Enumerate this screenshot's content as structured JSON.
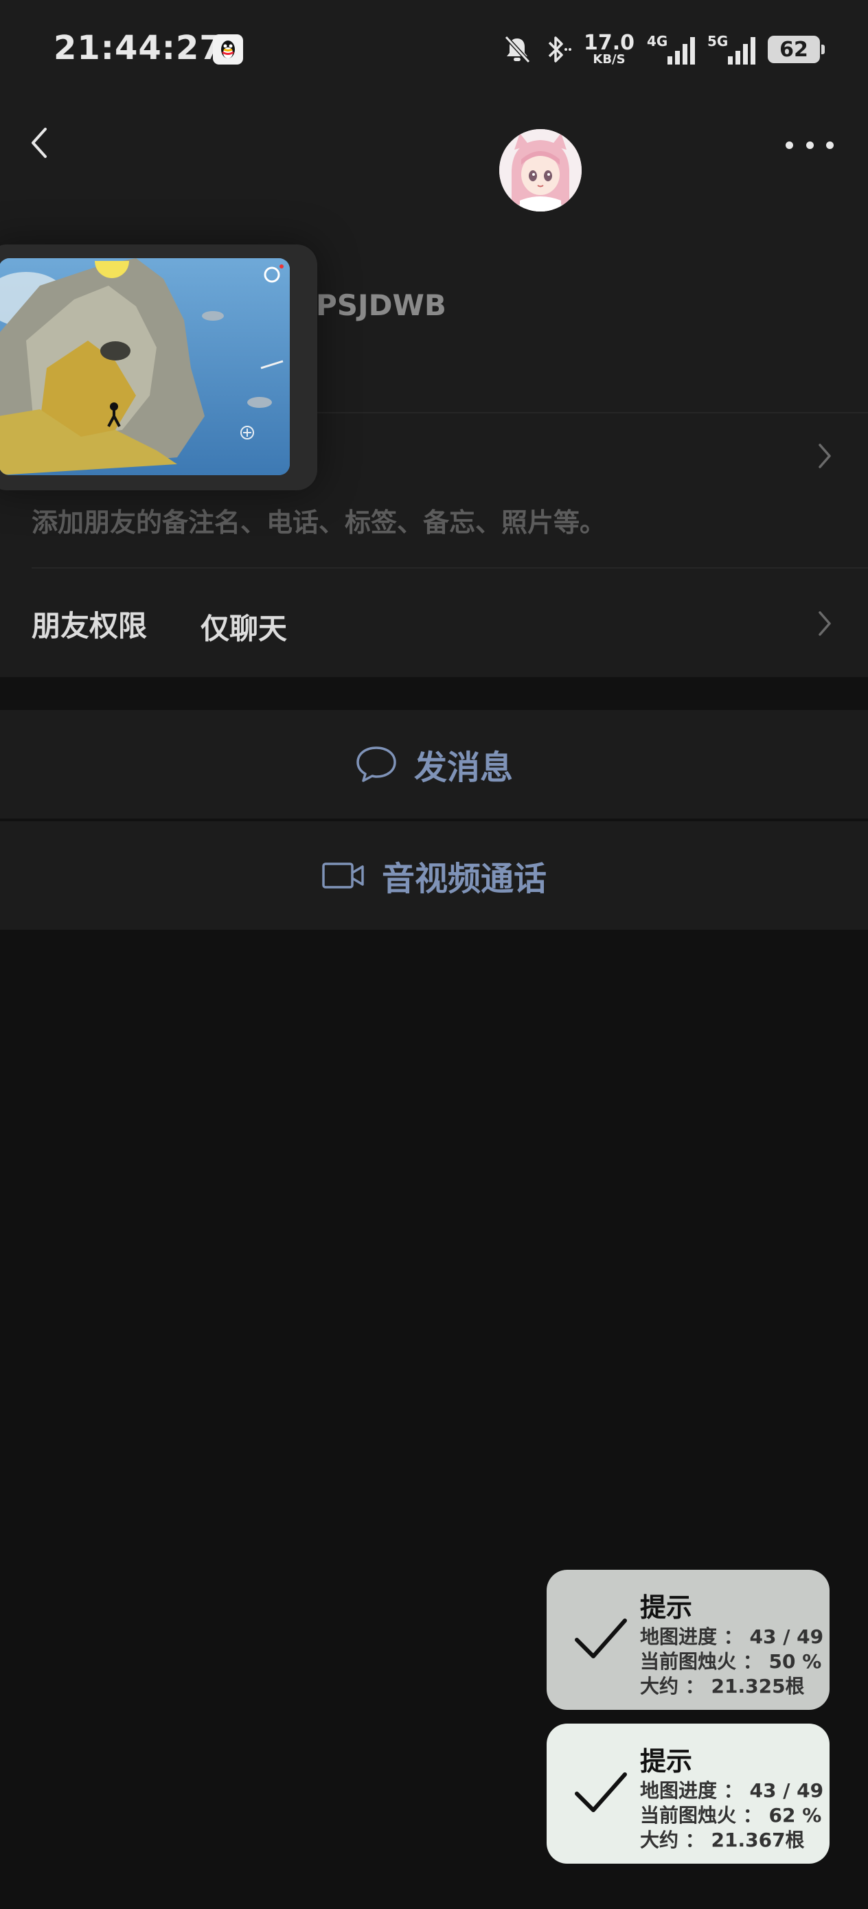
{
  "status_bar": {
    "time": "21:44:27",
    "speed_value": "17.0",
    "speed_unit": "KB/S",
    "net_4g": "4G",
    "net_5g": "5G",
    "battery": "62",
    "icons": [
      "qq-icon",
      "mute-icon",
      "bluetooth-icon",
      "signal-icon",
      "battery-icon"
    ]
  },
  "header": {
    "back_icon": "chevron-left-icon",
    "more_icon": "more-dots-icon"
  },
  "profile": {
    "nickname": "PSJDWB",
    "remark_hint": "添加朋友的备注名、电话、标签、备忘、照片等。",
    "permission_label": "朋友权限",
    "permission_value": "仅聊天"
  },
  "actions": {
    "send_message": "发消息",
    "video_call": "音视频通话"
  },
  "toasts": [
    {
      "title": "提示",
      "progress": "地图进度 ： 43 / 49",
      "candle": "当前图烛火 ： 50 %",
      "approx": "大约 ： 21.325根"
    },
    {
      "title": "提示",
      "progress": "地图进度 ： 43 / 49",
      "candle": "当前图烛火 ： 62 %",
      "approx": "大约 ： 21.367根"
    }
  ],
  "colors": {
    "page_bg": "#111111",
    "panel_bg": "#1c1c1c",
    "action_text": "#7f93b8",
    "toast_1_bg": "#c8cbc8",
    "toast_2_bg": "#e9efea"
  }
}
